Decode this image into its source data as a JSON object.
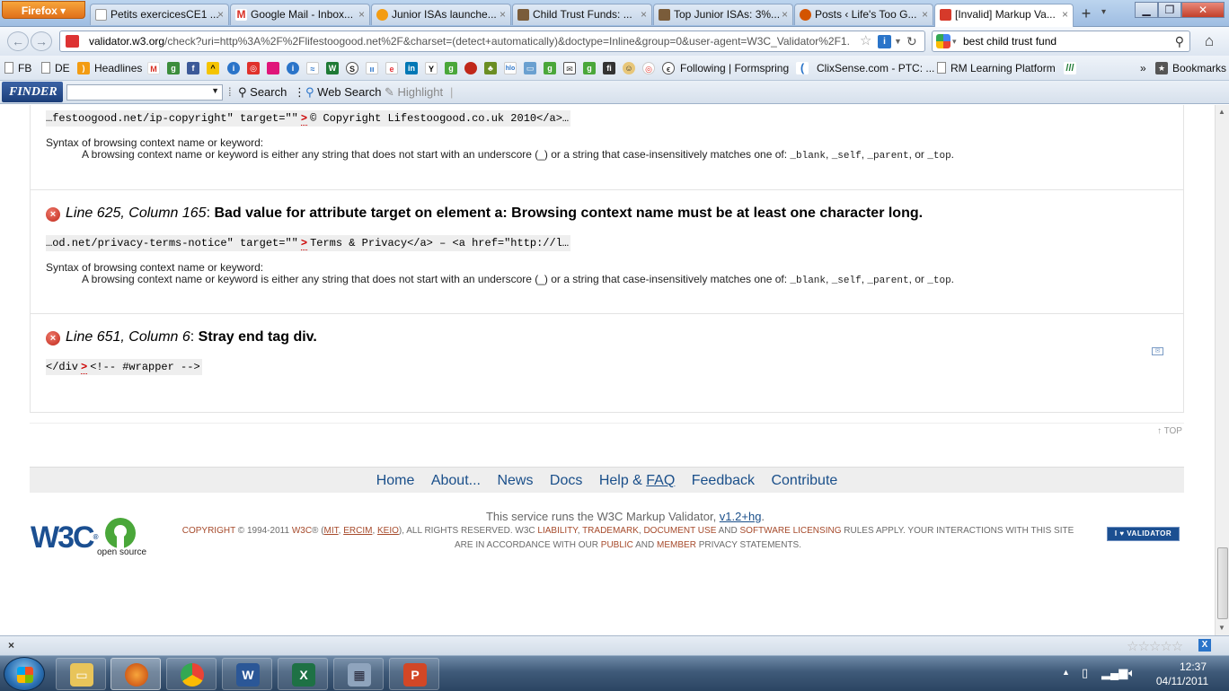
{
  "browser": {
    "menu_button": "Firefox",
    "tabs": [
      {
        "label": "Petits exercicesCE1 ...",
        "fav_color": "#ffffff"
      },
      {
        "label": "Google Mail - Inbox...",
        "fav_color": "#d93025"
      },
      {
        "label": "Junior ISAs launche...",
        "fav_color": "#f39c12"
      },
      {
        "label": "Child Trust Funds: ...",
        "fav_color": "#7a5c3a"
      },
      {
        "label": "Top Junior ISAs: 3%...",
        "fav_color": "#7a5c3a"
      },
      {
        "label": "Posts ‹ Life's Too G...",
        "fav_color": "#d35400"
      },
      {
        "label": "[Invalid] Markup Va...",
        "fav_color": "#d63a2a"
      }
    ],
    "new_tab": "+",
    "url_host": "validator.w3.org",
    "url_rest": "/check?uri=http%3A%2F%2Flifestoogood.net%2F&charset=(detect+automatically)&doctype=Inline&group=0&user-agent=W3C_Validator%2F1.",
    "search_value": "best child trust fund",
    "bookmarks": [
      {
        "label": "FB"
      },
      {
        "label": "DE"
      },
      {
        "label": "Headlines"
      },
      {
        "label": "Following | Formspring"
      },
      {
        "label": "ClixSense.com - PTC: ..."
      },
      {
        "label": "RM Learning Platform"
      }
    ],
    "bookmarks_menu": "Bookmarks",
    "overflow_chevron": "»"
  },
  "finder_toolbar": {
    "logo": "FINDER",
    "search_label": "Search",
    "web_search_label": "Web Search",
    "highlight_label": "Highlight"
  },
  "page": {
    "top_snippet": {
      "before": "…festoogood.net/ip-copyright\" target=\"\"",
      "marker": ">",
      "after": "© Copyright Lifestoogood.co.uk 2010</a>…"
    },
    "syntax_heading": "Syntax of browsing context name or keyword:",
    "syntax_desc_text": "A browsing context name or keyword is either any string that does not start with an underscore (_) or a string that case-insensitively matches one of:",
    "keywords": [
      "_blank",
      "_self",
      "_parent",
      "_top"
    ],
    "kw_sep1": ", ",
    "kw_sep2": ", ",
    "kw_sep3": ", or ",
    "kw_end": ".",
    "errors": [
      {
        "location": "Line 625, Column 165",
        "message": "Bad value for attribute target on element a: Browsing context name must be at least one character long.",
        "code_before": "…od.net/privacy-terms-notice\" target=\"\"",
        "code_marker": ">",
        "code_after": "Terms & Privacy</a> – <a href=\"http://l…"
      },
      {
        "location": "Line 651, Column 6",
        "message": "Stray end tag div.",
        "code_before": "</div",
        "code_marker": ">",
        "code_after": "<!-- #wrapper -->"
      }
    ],
    "colon": ": ",
    "top_link": "↑ TOP",
    "footer_nav": {
      "home": "Home",
      "about": "About...",
      "news": "News",
      "docs": "Docs",
      "help_pre": "Help & ",
      "help_faq": "FAQ",
      "feedback": "Feedback",
      "contribute": "Contribute"
    },
    "service_text": "This service runs the W3C Markup Validator, ",
    "service_version": "v1.2+hg",
    "service_end": ".",
    "w3c_logo": "W3C",
    "w3c_reg": "®",
    "opensource_label": "open source",
    "copyright": {
      "t1": "Copyright",
      "t2": " © 1994-2011 ",
      "t3": "W3C",
      "t4": "® (",
      "t5": "MIT",
      "t6": ", ",
      "t7": "ERCIM",
      "t8": ", ",
      "t9": "KEIO",
      "t10": "), All Rights Reserved. W3C ",
      "t11": "liability",
      "t12": ", ",
      "t13": "trademark",
      "t14": ", ",
      "t15": "document use",
      "t16": " and ",
      "t17": "software licensing",
      "t18": " rules apply. Your interactions with this site are in accordance with our ",
      "t19": "public",
      "t20": " and ",
      "t21": "Member",
      "t22": " privacy statements."
    },
    "validator_badge": "I ♥ VALIDATOR"
  },
  "statusbar": {
    "close": "×",
    "rating_stars": "☆☆☆☆☆"
  },
  "taskbar": {
    "time": "12:37",
    "date": "04/11/2011"
  }
}
